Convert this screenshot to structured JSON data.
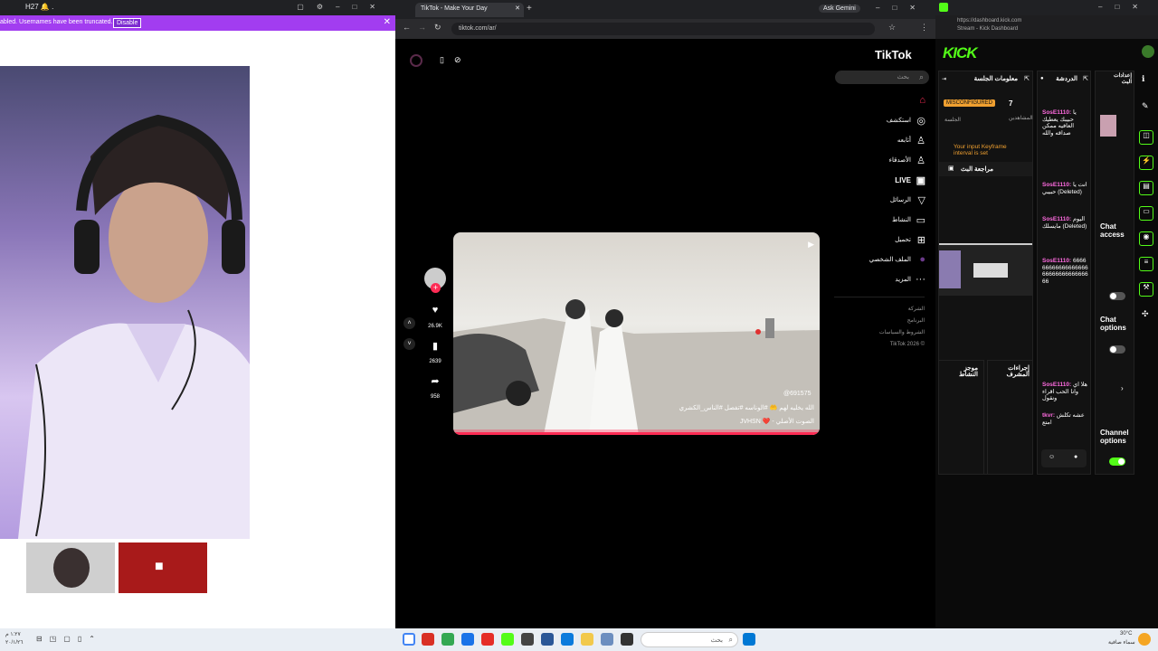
{
  "left_window": {
    "title": "H27 🔔 .",
    "banner_text": "abled. Usernames have been truncated.",
    "banner_button": "Disable"
  },
  "browser": {
    "tab_title": "TikTok - Make Your Day",
    "new_tab_symbol": "+",
    "gemini_label": "Ask Gemini",
    "url": "tiktok.com/ar/"
  },
  "tiktok": {
    "logo_text": "TikTok",
    "search_placeholder": "بحث",
    "nav": [
      {
        "label": "",
        "icon": "home-icon"
      },
      {
        "label": "استكشف",
        "icon": "explore-icon"
      },
      {
        "label": "أتابعه",
        "icon": "following-icon"
      },
      {
        "label": "الأصدقاء",
        "icon": "friends-icon"
      },
      {
        "label": "LIVE",
        "icon": "live-icon"
      },
      {
        "label": "الرسائل",
        "icon": "messages-icon"
      },
      {
        "label": "النشاط",
        "icon": "activity-icon"
      },
      {
        "label": "تحميل",
        "icon": "upload-icon"
      },
      {
        "label": "الملف الشخصي",
        "icon": "profile-icon"
      },
      {
        "label": "المزيد",
        "icon": "more-icon"
      }
    ],
    "footer": [
      "الشركة",
      "البرنامج",
      "الشروط والسياسات",
      "TikTok 2026 ©"
    ],
    "actions": {
      "likes": "26.9K",
      "saves": "2639",
      "shares": "958"
    },
    "video": {
      "caption": "الله يخليه لهم 🤲 #الوناسه #تفصل #الناس_الكشري",
      "sound": "JVHSN ❤️ - الصوت الأصلي",
      "watermark": "@691575"
    }
  },
  "kick": {
    "url_line1": "https://dashboard.kick.com",
    "url_line2": "Stream - Kick Dashboard",
    "logo": "KICK",
    "session_info_title": "معلومات الجلسة",
    "chat_title": "الدردشة",
    "badge": "MISCONFIGURED",
    "session_label": "الجلسة",
    "viewers_count": "7",
    "viewers_label": "المشاهدين",
    "keyframe_warning": "Your input Keyframe interval is set",
    "stream_review": "مراجعة البث",
    "mod_actions": "إجراءات المشرف",
    "activity_feed": "موجز النشاط",
    "chat_messages": [
      {
        "user": "SosE1110:",
        "text": "يا حبيبك يعطيك العافيه ممكن صداقه والله"
      },
      {
        "user": "SosE1110:",
        "text": "انت يا حبيبي (Deleted)"
      },
      {
        "user": "SosE1110:",
        "text": "اليوم مايسلك (Deleted)"
      },
      {
        "user": "SosE1110:",
        "text": "6666666666666666666666666666666666"
      },
      {
        "user": "SosE1110:",
        "text": "هلا اي وانا الحب اقراء ونقول"
      },
      {
        "user": "tkvr:",
        "text": "عشه تكلش امتع"
      }
    ],
    "chat_access": "Chat access",
    "chat_options": "Chat options",
    "channel_options": "Channel options",
    "stream_sidebar_title": "إعدادات البث"
  },
  "taskbar": {
    "search_placeholder": "بحث",
    "time": "30°C",
    "date_line": "سماء صافية",
    "clock_left": "١:٢٧ م",
    "date_left": "٢٠/١/٢٦"
  }
}
